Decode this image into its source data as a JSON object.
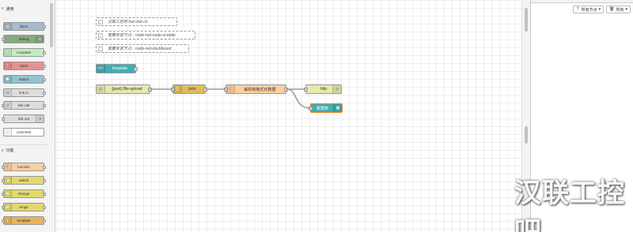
{
  "palette": {
    "categories": [
      {
        "label": "通用"
      },
      {
        "label": "功能"
      }
    ],
    "common_nodes": [
      {
        "label": "inject",
        "color": "#a6bbcf"
      },
      {
        "label": "debug",
        "color": "#87a980"
      },
      {
        "label": "complete",
        "color": "#c0edc0"
      },
      {
        "label": "catch",
        "color": "#e49191"
      },
      {
        "label": "status",
        "color": "#94c1d0"
      },
      {
        "label": "link in",
        "color": "#dddddd"
      },
      {
        "label": "link call",
        "color": "#dddddd"
      },
      {
        "label": "link out",
        "color": "#dddddd"
      },
      {
        "label": "comment",
        "color": "#ffffff"
      }
    ],
    "function_nodes": [
      {
        "label": "function",
        "color": "#fdd0a2"
      },
      {
        "label": "switch",
        "color": "#e2d96e"
      },
      {
        "label": "change",
        "color": "#e2d96e"
      },
      {
        "label": "range",
        "color": "#e2d96e"
      },
      {
        "label": "template",
        "color": "#e6b45f"
      }
    ]
  },
  "workspace": {
    "comments": [
      {
        "label": "汉联工控吧 han-link.cn"
      },
      {
        "label": "需要安装节点：node-red-node-ui-table"
      },
      {
        "label": "需要安装节点：node-red-dashboard"
      }
    ],
    "nodes": {
      "template": {
        "label": "template",
        "color": "#3fadb5"
      },
      "file_upload": {
        "label": "[post] /file-upload",
        "color": "#e7e7ae"
      },
      "json": {
        "label": "json",
        "color": "#debd5c"
      },
      "parse": {
        "label": "解析和格式化数据",
        "color": "#fdd0a2"
      },
      "http": {
        "label": "http",
        "color": "#e7e7ae"
      },
      "table": {
        "label": "数据表",
        "color": "#3fadb5"
      }
    }
  },
  "sidebar": {
    "filter_nodes_label": "所有节点",
    "filter_all_label": "所有"
  },
  "watermark": {
    "text": "汉联工控吧"
  }
}
